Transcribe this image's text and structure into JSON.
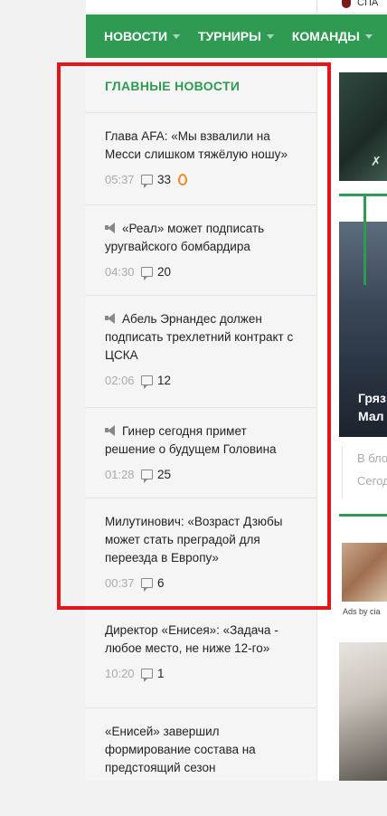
{
  "top_bar": {
    "club_label": "СПА"
  },
  "nav": {
    "items": [
      {
        "label": "НОВОСТИ"
      },
      {
        "label": "ТУРНИРЫ"
      },
      {
        "label": "КОМАНДЫ"
      }
    ]
  },
  "news": {
    "heading": "ГЛАВНЫЕ НОВОСТИ",
    "items": [
      {
        "headline": "Глава AFA: «Мы взвалили на Месси слишком тяжёлую ношу»",
        "time": "05:37",
        "comments": "33",
        "hot": true,
        "announce": false
      },
      {
        "headline": "«Реал» может подписать уругвайского бомбардира",
        "time": "04:30",
        "comments": "20",
        "hot": false,
        "announce": true
      },
      {
        "headline": "Абель Эрнандес должен подписать трехлетний контракт с ЦСКА",
        "time": "02:06",
        "comments": "12",
        "hot": false,
        "announce": true
      },
      {
        "headline": "Гинер сегодня примет решение о будущем Головина",
        "time": "01:28",
        "comments": "25",
        "hot": false,
        "announce": true
      },
      {
        "headline": "Милутинович: «Возраст Дзюбы может стать преградой для переезда в Европу»",
        "time": "00:37",
        "comments": "6",
        "hot": false,
        "announce": false
      },
      {
        "headline": "Директор «Енисея»: «Задача - любое место, не ниже 12-го»",
        "time": "10:20",
        "comments": "1",
        "hot": false,
        "announce": false
      },
      {
        "headline": "«Енисей» завершил формирование состава на предстоящий сезон",
        "time": "",
        "comments": "",
        "hot": false,
        "announce": false
      }
    ]
  },
  "right_column": {
    "feature_title_line1": "Гряз",
    "feature_title_line2": "Мал",
    "text_line1": "В бло",
    "text_line2": "Сегод",
    "ad_label": "Ads by cia"
  },
  "colors": {
    "brand_green": "#2e9a52",
    "highlight_red": "#e8141b",
    "fire_orange": "#f08a24"
  }
}
